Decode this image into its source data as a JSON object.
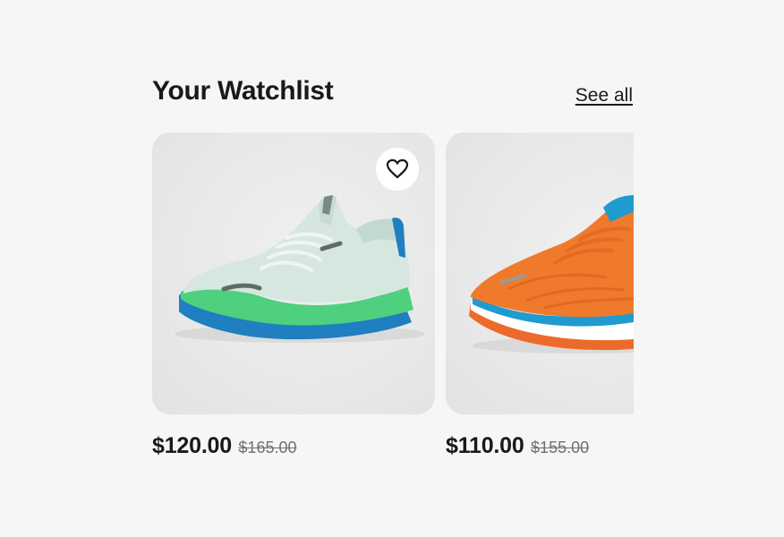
{
  "header": {
    "title": "Your Watchlist",
    "see_all_label": "See all"
  },
  "items": [
    {
      "image": "mint-green-running-shoe",
      "price": "$120.00",
      "original_price": "$165.00",
      "watch_icon": "heart-icon",
      "colors": {
        "upper": "#d6e7df",
        "sole": "#4fd07f",
        "outsole": "#1f7fc0"
      }
    },
    {
      "image": "orange-running-shoe",
      "price": "$110.00",
      "original_price": "$155.00",
      "colors": {
        "upper": "#f07a2c",
        "midsole": "#ffffff",
        "accent": "#1f9bd0"
      }
    }
  ]
}
